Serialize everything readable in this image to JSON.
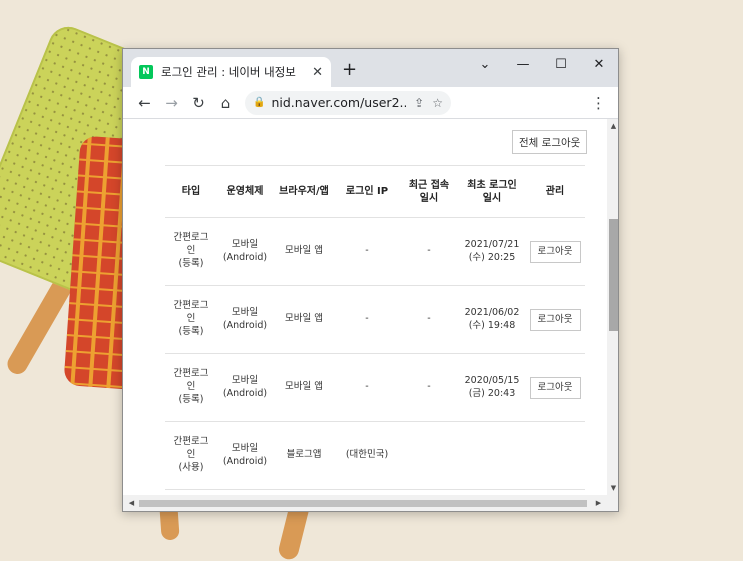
{
  "browser": {
    "tab_title": "로그인 관리 : 네이버 내정보",
    "favicon_letter": "N",
    "url": "nid.naver.com/user2...",
    "icons": {
      "back": "arrow-left-icon",
      "forward": "arrow-right-icon",
      "reload": "reload-icon",
      "home": "home-icon",
      "lock": "lock-icon",
      "share": "share-icon",
      "bookmark": "star-icon",
      "menu": "kebab-menu-icon",
      "new_tab": "plus-icon",
      "close_tab": "close-icon"
    }
  },
  "page": {
    "logout_all_label": "전체 로그아웃",
    "headers": {
      "type": "타입",
      "os": "운영체제",
      "browser": "브라우저/앱",
      "ip": "로그인 IP",
      "last_access": "최근 접속\n일시",
      "first_login": "최초 로그인\n일시",
      "manage": "관리"
    },
    "rows": [
      {
        "type": "간편로그\n인\n(등록)",
        "os": "모바일\n(Android)",
        "browser": "모바일 앱",
        "ip": "-",
        "last_access": "-",
        "first_login": "2021/07/21\n(수) 20:25",
        "action": "로그아웃"
      },
      {
        "type": "간편로그\n인\n(등록)",
        "os": "모바일\n(Android)",
        "browser": "모바일 앱",
        "ip": "-",
        "last_access": "-",
        "first_login": "2021/06/02\n(수) 19:48",
        "action": "로그아웃"
      },
      {
        "type": "간편로그\n인\n(등록)",
        "os": "모바일\n(Android)",
        "browser": "모바일 앱",
        "ip": "-",
        "last_access": "-",
        "first_login": "2020/05/15\n(금) 20:43",
        "action": "로그아웃"
      },
      {
        "type": "간편로그\n인\n(사용)",
        "os": "모바일\n(Android)",
        "browser": "블로그앱",
        "ip": "(대한민국)",
        "last_access": "",
        "first_login": "",
        "action": ""
      }
    ]
  }
}
